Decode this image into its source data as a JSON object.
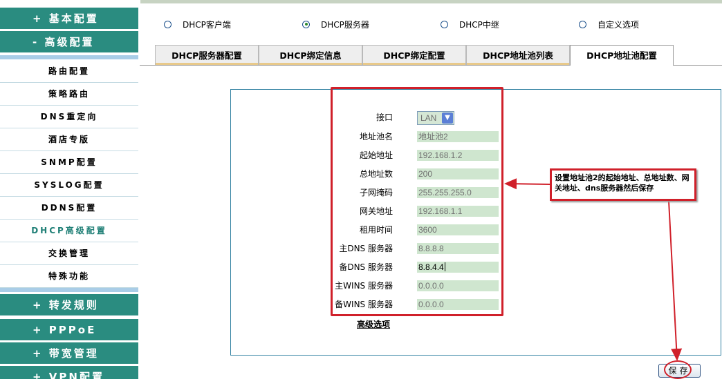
{
  "sidebar": {
    "sections_top": [
      {
        "label": "+ 基本配置"
      },
      {
        "label": "- 高级配置"
      }
    ],
    "items": [
      {
        "label": "路由配置"
      },
      {
        "label": "策略路由"
      },
      {
        "label": "DNS重定向"
      },
      {
        "label": "酒店专版"
      },
      {
        "label": "SNMP配置"
      },
      {
        "label": "SYSLOG配置"
      },
      {
        "label": "DDNS配置"
      },
      {
        "label": "DHCP高级配置",
        "active": true
      },
      {
        "label": "交换管理"
      },
      {
        "label": "特殊功能"
      }
    ],
    "sections_bottom": [
      {
        "label": "+ 转发规则"
      },
      {
        "label": "+ PPPoE"
      },
      {
        "label": "+ 带宽管理"
      },
      {
        "label": "+ VPN配置"
      }
    ]
  },
  "mode_options": [
    {
      "label": "DHCP客户端",
      "checked": false
    },
    {
      "label": "DHCP服务器",
      "checked": true
    },
    {
      "label": "DHCP中继",
      "checked": false
    },
    {
      "label": "自定义选项",
      "checked": false
    }
  ],
  "tabs": [
    {
      "label": "DHCP服务器配置"
    },
    {
      "label": "DHCP绑定信息"
    },
    {
      "label": "DHCP绑定配置"
    },
    {
      "label": "DHCP地址池列表"
    },
    {
      "label": "DHCP地址池配置",
      "active": true
    }
  ],
  "form": {
    "interface": {
      "label": "接口",
      "value": "LAN"
    },
    "fields": [
      {
        "label": "地址池名",
        "value": "地址池2"
      },
      {
        "label": "起始地址",
        "value": "192.168.1.2"
      },
      {
        "label": "总地址数",
        "value": "200"
      },
      {
        "label": "子网掩码",
        "value": "255.255.255.0"
      },
      {
        "label": "网关地址",
        "value": "192.168.1.1"
      },
      {
        "label": "租用时间",
        "value": "3600"
      },
      {
        "label": "主DNS 服务器",
        "value": "8.8.8.8"
      },
      {
        "label": "备DNS 服务器",
        "value": "8.8.4.4",
        "focused": true
      },
      {
        "label": "主WINS 服务器",
        "value": "0.0.0.0"
      },
      {
        "label": "备WINS 服务器",
        "value": "0.0.0.0"
      }
    ],
    "advanced_link": "高级选项",
    "save_label": "保存"
  },
  "annotation": {
    "text": "设置地址池2的起始地址、总地址数、网关地址、dns服务器然后保存",
    "color": "#d0202a"
  },
  "colors": {
    "sidebar_accent": "#2a8c80",
    "input_bg": "#cfe6cf",
    "frame_border": "#2f7fa0"
  }
}
